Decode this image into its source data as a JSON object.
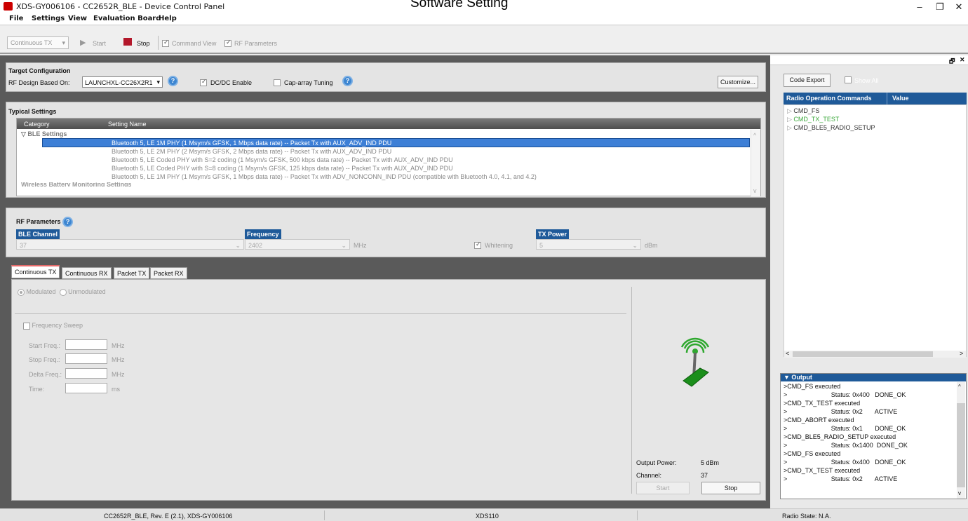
{
  "window": {
    "title": "XDS-GY006106 - CC2652R_BLE - Device Control Panel",
    "overlay_title": "Software Setting",
    "controls": [
      "–",
      "❐",
      "✕"
    ]
  },
  "menu": [
    "File",
    "Settings",
    "View",
    "Evaluation Board",
    "Help"
  ],
  "toolbar": {
    "mode": "Continuous TX",
    "start": "Start",
    "stop": "Stop",
    "command_view": "Command View",
    "rf_parameters": "RF Parameters"
  },
  "target": {
    "title": "Target Configuration",
    "rf_design_label": "RF Design Based On:",
    "rf_design_value": "LAUNCHXL-CC26X2R1",
    "dcdc": "DC/DC Enable",
    "cap_array": "Cap-array Tuning",
    "customize": "Customize..."
  },
  "typical": {
    "title": "Typical Settings",
    "col_category": "Category",
    "col_setting": "Setting Name",
    "group": "BLE Settings",
    "rows": [
      "Bluetooth 5, LE 1M PHY (1 Msym/s GFSK, 1 Mbps data rate) -- Packet Tx with AUX_ADV_IND PDU",
      "Bluetooth 5, LE 2M PHY (2 Msym/s GFSK, 2 Mbps data rate) -- Packet Tx with AUX_ADV_IND PDU",
      "Bluetooth 5, LE Coded PHY with S=2 coding (1 Msym/s GFSK, 500 kbps data rate) -- Packet Tx with AUX_ADV_IND PDU",
      "Bluetooth 5, LE Coded PHY with S=8 coding (1 Msym/s GFSK, 125 kbps data rate) -- Packet Tx with AUX_ADV_IND PDU",
      "Bluetooth 5, LE 1M PHY (1 Msym/s GFSK, 1 Mbps data rate) -- Packet Tx with ADV_NONCONN_IND PDU (compatible with Bluetooth 4.0, 4.1, and 4.2)"
    ],
    "next_group": "Wireless Battery Monitoring Settings"
  },
  "rf": {
    "title": "RF Parameters",
    "ble_channel_label": "BLE Channel",
    "ble_channel": "37",
    "frequency_label": "Frequency",
    "frequency": "2402",
    "freq_unit": "MHz",
    "whitening": "Whitening",
    "tx_power_label": "TX Power",
    "tx_power": "5",
    "power_unit": "dBm"
  },
  "tabs": [
    "Continuous TX",
    "Continuous RX",
    "Packet TX",
    "Packet RX"
  ],
  "ctx": {
    "modulated": "Modulated",
    "unmodulated": "Unmodulated",
    "freq_sweep": "Frequency Sweep",
    "start_freq": "Start Freq.:",
    "stop_freq": "Stop Freq.:",
    "delta_freq": "Delta Freq.:",
    "time": "Time:",
    "mhz": "MHz",
    "ms": "ms",
    "output_power_label": "Output Power:",
    "output_power": "5 dBm",
    "channel_label": "Channel:",
    "channel": "37",
    "start": "Start",
    "stop": "Stop"
  },
  "right": {
    "code_export": "Code Export",
    "show_all": "Show All",
    "col_cmd": "Radio Operation Commands",
    "col_value": "Value",
    "commands": [
      "CMD_FS",
      "CMD_TX_TEST",
      "CMD_BLE5_RADIO_SETUP"
    ],
    "output_title": "Output",
    "output_lines": [
      ">CMD_FS executed",
      ">                         Status: 0x400   DONE_OK",
      ">CMD_TX_TEST executed",
      ">                         Status: 0x2       ACTIVE",
      ">CMD_ABORT executed",
      ">                         Status: 0x1       DONE_OK",
      ">CMD_BLE5_RADIO_SETUP executed",
      ">                         Status: 0x1400  DONE_OK",
      ">CMD_FS executed",
      ">                         Status: 0x400   DONE_OK",
      ">CMD_TX_TEST executed",
      ">                         Status: 0x2       ACTIVE"
    ]
  },
  "status": {
    "device": "CC2652R_BLE, Rev. E (2.1), XDS-GY006106",
    "probe": "XDS110",
    "radio_state": "Radio State: N.A."
  },
  "colors": {
    "accent": "#1f5a99",
    "selected_row": "#3d7fd6",
    "active_cmd": "#3aa83a"
  }
}
